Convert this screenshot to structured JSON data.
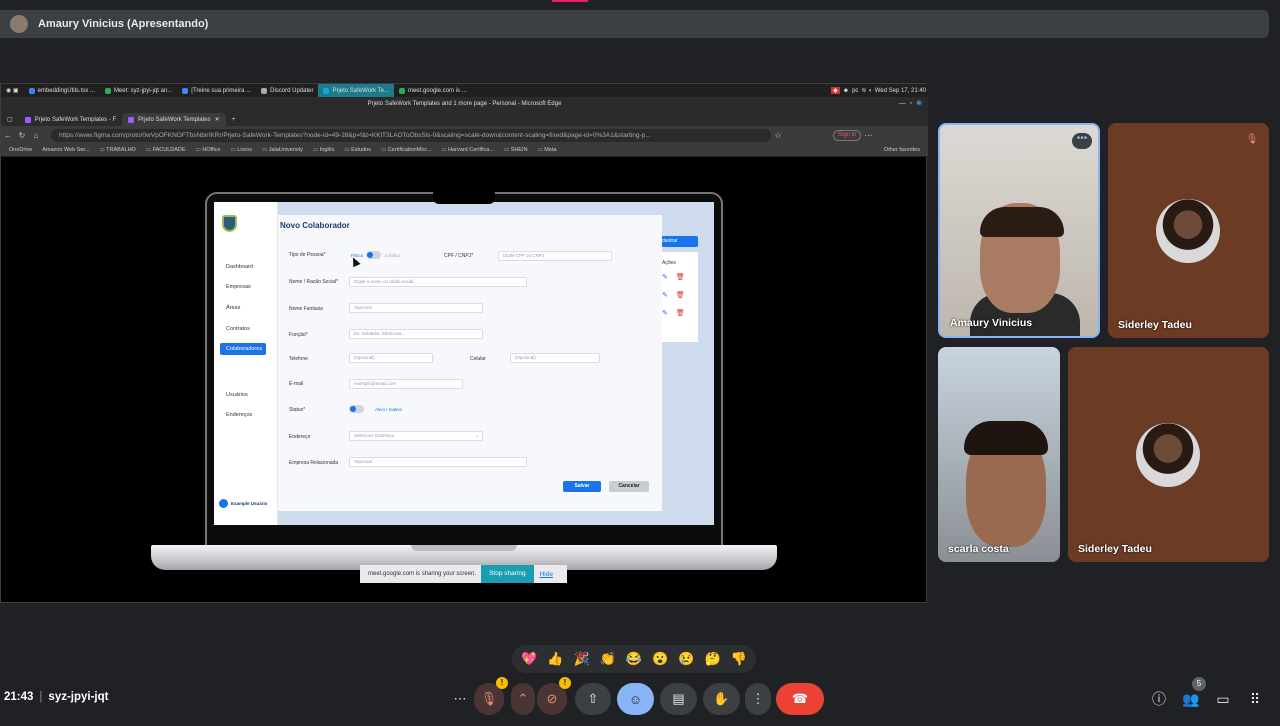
{
  "presenter": {
    "name": "Amaury Vinicius (Apresentando)"
  },
  "taskbar": {
    "tasks": [
      "embeddingUtils.tsx ...",
      "Meet: syz-jpyi-jqt an...",
      "[Treine sua primeira ...",
      "Discord Updater",
      "Prjeto SafeWork Te...",
      "meet.google.com is ..."
    ],
    "clock": "Wed Sep 17, 21:40",
    "tray_pc": "pc"
  },
  "browser": {
    "window_title": "Prjeto SafeWork Templates and 1 more page - Personal - Microsoft Edge",
    "tabs": [
      "Prjeto SafeWork Templates - F",
      "Prjeto SafeWork Templates"
    ],
    "url": "https://www.figma.com/proto/0wVpOFKNOFTbsNbirIKRr/Prjeto-SafeWork-Templates?node-id=49-28&p=f&t=KKlT3LAOToObsSis-0&scaling=scale-down&content-scaling=fixed&page-id=0%3A1&starting-p...",
    "sign_in": "Sign in",
    "favorites": [
      "OneDrive",
      "Amazon Web Ser...",
      "TRABALHO",
      "FACULDADE",
      "HOffice",
      "Livros",
      "JalaUniversity",
      "Inglês",
      "Estudos",
      "CertificationMicr...",
      "Harvard Certifica...",
      "SHEIN",
      "Meta"
    ],
    "other_favorites": "Other favorites"
  },
  "app": {
    "nav": [
      "Dashboard",
      "Empresas",
      "Áreas",
      "Contratos",
      "Colaboradores",
      "Usuários",
      "Endereços"
    ],
    "user": "Example Usuário",
    "bg_button": "dastrar",
    "bg_col": "Ações"
  },
  "form": {
    "title": "Novo Colaborador",
    "tipo_pessoa": {
      "label": "Tipo de Pessoa*",
      "on": "Física",
      "off": "Jurídica"
    },
    "cpf": {
      "label": "CPF / CNPJ*",
      "placeholder": "Digite CPF ou CNPJ"
    },
    "nome": {
      "label": "Nome / Razão Social*",
      "placeholder": "Digite o nome ou razão social"
    },
    "fantasia": {
      "label": "Nome Fantasia",
      "placeholder": "Opcional"
    },
    "funcao": {
      "label": "Função*",
      "placeholder": "Ex: Soldador, Eletricista..."
    },
    "telefone": {
      "label": "Telefone",
      "placeholder": "(Opcional)"
    },
    "celular": {
      "label": "Celular",
      "placeholder": "(Opcional)"
    },
    "email": {
      "label": "E-mail",
      "placeholder": "exemplo@email.com"
    },
    "status": {
      "label": "Status*",
      "value": "Ativo / Inativo"
    },
    "endereco": {
      "label": "Endereço",
      "placeholder": "Selecione Endereço"
    },
    "empresa": {
      "label": "Empresa Relacionada",
      "placeholder": "Opcional"
    },
    "save": "Salvar",
    "cancel": "Cancelar"
  },
  "share": {
    "message": "meet.google.com is sharing your screen.",
    "stop": "Stop sharing",
    "hide": "Hide"
  },
  "participants": [
    "Amaury Vinicius",
    "Siderley Tadeu",
    "scarla costa",
    "Siderley Tadeu"
  ],
  "reactions": [
    "💖",
    "👍",
    "🎉",
    "👏",
    "😂",
    "😮",
    "😢",
    "🤔",
    "👎"
  ],
  "meeting": {
    "time": "21:43",
    "code": "syz-jpyi-jqt",
    "participant_count": "5",
    "mic_warning": "!",
    "cam_warning": "!"
  },
  "colors": {
    "accent": "#8ab4f8",
    "end_call": "#ea4335",
    "share_blue": "#1a9db0",
    "warn": "#fbbc04"
  }
}
